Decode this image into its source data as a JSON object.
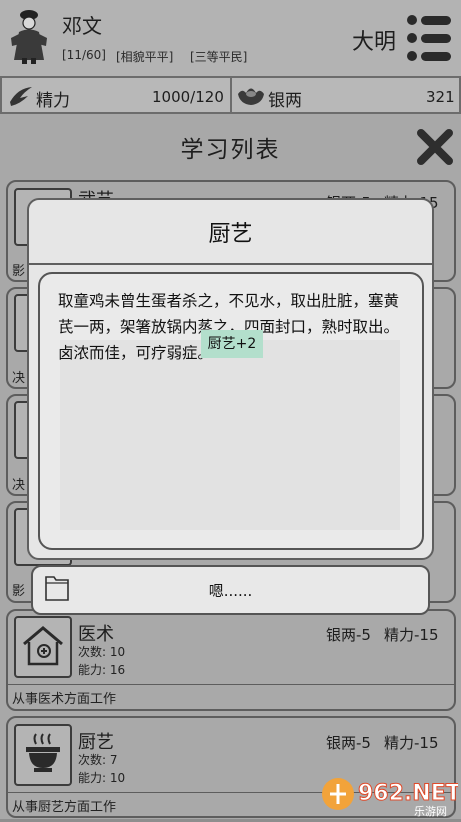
{
  "player": {
    "name": "邓文",
    "age": "[11/60]",
    "appearance": "[相貌平平]",
    "rank": "[三等平民]",
    "dynasty": "大明"
  },
  "stats": {
    "energy_label": "精力",
    "energy_value": "1000/120",
    "silver_label": "银两",
    "silver_value": "321"
  },
  "list": {
    "title": "学习列表",
    "items": [
      {
        "name": "武艺",
        "cost_silver": "银两-5",
        "cost_energy": "精力-15",
        "desc": "影"
      },
      {
        "name": "",
        "cost_silver": "",
        "cost_energy": "",
        "desc": "决"
      },
      {
        "name": "",
        "cost_silver": "",
        "cost_energy": "",
        "desc": "决"
      },
      {
        "name": "",
        "cost_silver": "",
        "cost_energy": "",
        "desc": "影"
      },
      {
        "name": "医术",
        "cost_silver": "银两-5",
        "cost_energy": "精力-15",
        "count": "次数: 10",
        "ability": "能力: 16",
        "desc": "从事医术方面工作"
      },
      {
        "name": "厨艺",
        "cost_silver": "银两-5",
        "cost_energy": "精力-15",
        "count": "次数: 7",
        "ability": "能力: 10",
        "desc": "从事厨艺方面工作"
      }
    ]
  },
  "modal": {
    "title": "厨艺",
    "text": "取童鸡未曾生蛋者杀之，不见水，取出肚脏，塞黄芪一两，架箸放锅内蒸之，四面封口，熟时取出。卤浓而佳，可疗弱症。",
    "toast": "厨艺+2",
    "confirm_label": "嗯......"
  },
  "watermark": {
    "brand": "962.NET",
    "sub": "乐游网"
  }
}
